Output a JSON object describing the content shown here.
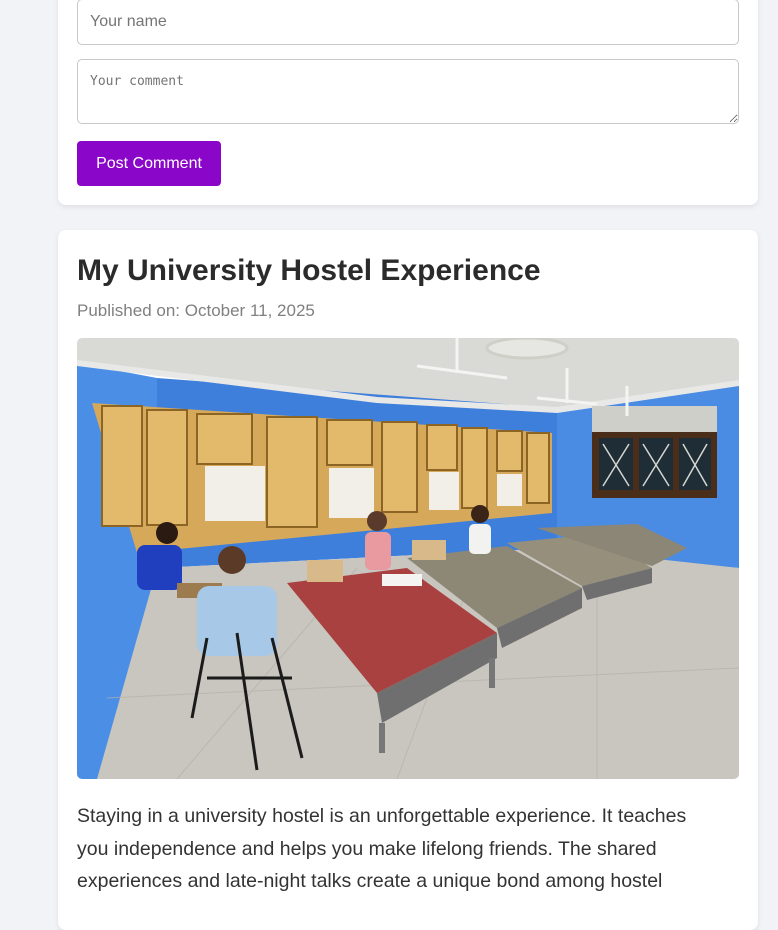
{
  "comment_form": {
    "name_placeholder": "Your name",
    "comment_placeholder": "Your comment",
    "submit_label": "Post Comment"
  },
  "post": {
    "title": "My University Hostel Experience",
    "date_line": "Published on: October 11, 2025",
    "image_alt": "Students studying in a university hostel dormitory room",
    "body": "Staying in a university hostel is an unforgettable experience. It teaches you independence and helps you make lifelong friends. The shared experiences and late-night talks create a unique bond among hostel"
  },
  "colors": {
    "accent": "#8a07c9",
    "page_bg": "#f2f3f7",
    "wall": "#4a86e0"
  }
}
